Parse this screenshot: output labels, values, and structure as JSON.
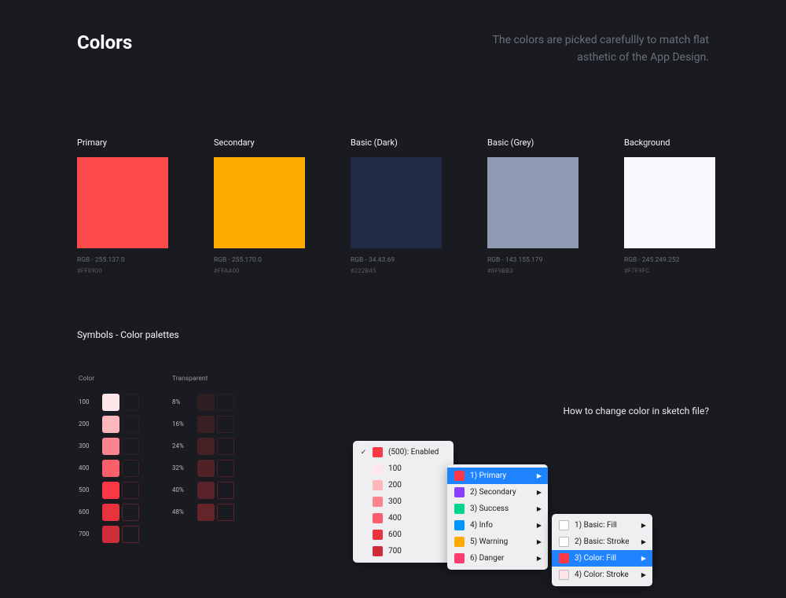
{
  "header": {
    "title": "Colors",
    "subtitle_line1": "The colors are picked carefullly to match flat",
    "subtitle_line2": "asthetic of the App Design."
  },
  "swatches": [
    {
      "label": "Primary",
      "color": "#fd4b4b",
      "rgb": "RGB - 255.137.0",
      "hex": "#FF8900"
    },
    {
      "label": "Secondary",
      "color": "#ffaa00",
      "rgb": "RGB - 255.170.0",
      "hex": "#FFAA00"
    },
    {
      "label": "Basic (Dark)",
      "color": "#222b45",
      "rgb": "RGB - 34.43.69",
      "hex": "#222B45"
    },
    {
      "label": "Basic (Grey)",
      "color": "#8f9bb3",
      "rgb": "RGB - 143.155.179",
      "hex": "#8F9BB3"
    },
    {
      "label": "Background",
      "color": "#f7f9fc",
      "rgb": "RGB - 245.249.252",
      "hex": "#F7F9FC"
    }
  ],
  "section2_title": "Symbols - Color palettes",
  "palette_color": {
    "head": "Color",
    "rows": [
      {
        "n": "100",
        "fill": "#fde7ea",
        "stroke": "#2a2128"
      },
      {
        "n": "200",
        "fill": "#fcb6bc",
        "stroke": "#2a2128"
      },
      {
        "n": "300",
        "fill": "#fb858f",
        "stroke": "#352129"
      },
      {
        "n": "400",
        "fill": "#fb5f6c",
        "stroke": "#41222a"
      },
      {
        "n": "500",
        "fill": "#fb3946",
        "stroke": "#49222b"
      },
      {
        "n": "600",
        "fill": "#e8333f",
        "stroke": "#57232c"
      },
      {
        "n": "700",
        "fill": "#cc2d38",
        "stroke": "#5e242e"
      }
    ]
  },
  "palette_transparent": {
    "head": "Transparent",
    "rows": [
      {
        "n": "8%",
        "fill": "#2f1f23",
        "stroke": "#2f1f23"
      },
      {
        "n": "16%",
        "fill": "#3a2024",
        "stroke": "#3a2024"
      },
      {
        "n": "24%",
        "fill": "#452126",
        "stroke": "#452126"
      },
      {
        "n": "32%",
        "fill": "#4f2227",
        "stroke": "#4f2227"
      },
      {
        "n": "40%",
        "fill": "#5a2329",
        "stroke": "#5a2329"
      },
      {
        "n": "48%",
        "fill": "#64252a",
        "stroke": "#64252a"
      }
    ]
  },
  "howto": "How to change color in sketch file?",
  "menu1": {
    "items": [
      {
        "check": "✓",
        "sw": "#fb3946",
        "label": "(500): Enabled"
      },
      {
        "check": "",
        "sw": "#fde7ea",
        "label": "100"
      },
      {
        "check": "",
        "sw": "#fcb6bc",
        "label": "200"
      },
      {
        "check": "",
        "sw": "#fb858f",
        "label": "300"
      },
      {
        "check": "",
        "sw": "#fb5f6c",
        "label": "400"
      },
      {
        "check": "",
        "sw": "#e8333f",
        "label": "600"
      },
      {
        "check": "",
        "sw": "#cc2d38",
        "label": "700"
      }
    ]
  },
  "menu2": {
    "items": [
      {
        "sw": "#fb3946",
        "label": "1) Primary",
        "hl": true
      },
      {
        "sw": "#8a3ffc",
        "label": "2) Secondary",
        "hl": false
      },
      {
        "sw": "#00d68f",
        "label": "3) Success",
        "hl": false
      },
      {
        "sw": "#0095ff",
        "label": "4) Info",
        "hl": false
      },
      {
        "sw": "#ffaa00",
        "label": "5) Warning",
        "hl": false
      },
      {
        "sw": "#ff3d71",
        "label": "6) Danger",
        "hl": false
      }
    ]
  },
  "menu3": {
    "items": [
      {
        "sw": "#ffffff",
        "outline": true,
        "label": "1) Basic: Fill",
        "hl": false
      },
      {
        "sw": "#ffffff",
        "outline": true,
        "label": "2) Basic: Stroke",
        "hl": false
      },
      {
        "sw": "#fb3946",
        "outline": false,
        "label": "3) Color: Fill",
        "hl": true
      },
      {
        "sw": "#ffe5e8",
        "outline": true,
        "label": "4) Color: Stroke",
        "hl": false
      }
    ]
  }
}
